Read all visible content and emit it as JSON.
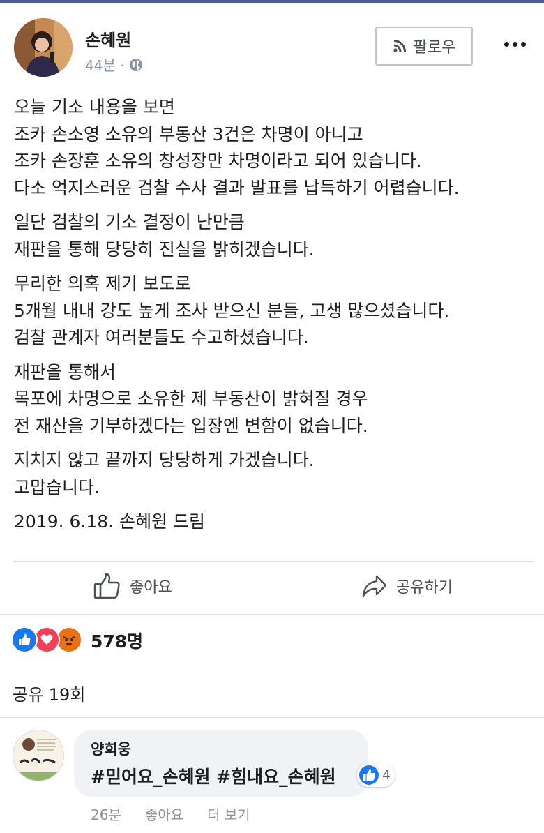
{
  "post": {
    "author": "손혜원",
    "time": "44분 ·",
    "follow_label": "팔로우",
    "paragraphs": [
      [
        "오늘 기소 내용을 보면",
        "조카 손소영 소유의 부동산 3건은 차명이 아니고",
        "조카 손장훈 소유의 창성장만 차명이라고 되어 있습니다.",
        "다소 억지스러운 검찰 수사 결과 발표를 납득하기 어렵습니다."
      ],
      [
        "일단 검찰의 기소 결정이 난만큼",
        "재판을 통해 당당히 진실을 밝히겠습니다."
      ],
      [
        "무리한 의혹 제기 보도로",
        "5개월 내내 강도 높게 조사 받으신 분들, 고생 많으셨습니다.",
        "검찰 관계자 여러분들도 수고하셨습니다."
      ],
      [
        "재판을 통해서",
        "목포에 차명으로 소유한 제 부동산이 밝혀질 경우",
        "전 재산을 기부하겠다는 입장엔 변함이 없습니다."
      ],
      [
        "지치지 않고 끝까지 당당하게 가겠습니다.",
        "고맙습니다."
      ],
      [
        "2019. 6.18. 손혜원 드림"
      ]
    ]
  },
  "actions": {
    "like_label": "좋아요",
    "share_label": "공유하기"
  },
  "stats": {
    "reaction_count": "578명",
    "share_count": "공유 19회"
  },
  "comment": {
    "author": "양희웅",
    "text": "#믿어요_손혜원 #힘내요_손혜원",
    "like_count": "4",
    "time": "26분",
    "like_label": "좋아요",
    "more_label": "더 보기"
  },
  "colors": {
    "like_blue": "#1877f2",
    "love_red": "#f33e58",
    "angry_orange": "#e9710f",
    "muted_text": "#8d949e"
  }
}
